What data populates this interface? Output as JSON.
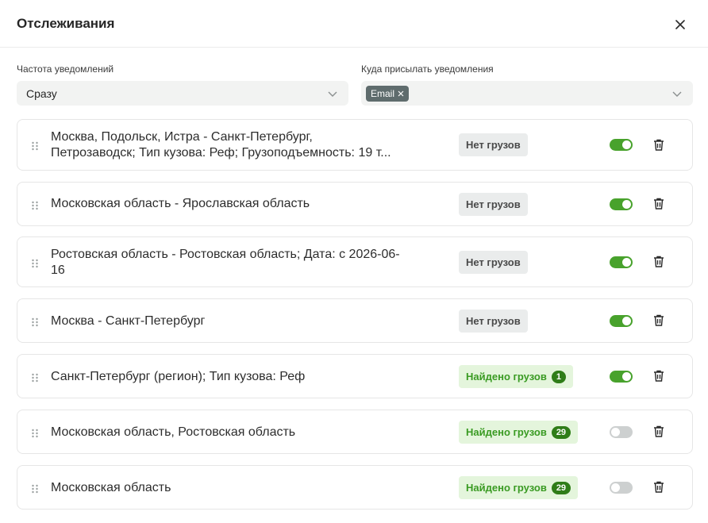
{
  "header": {
    "title": "Отслеживания"
  },
  "frequency": {
    "label": "Частота уведомлений",
    "value": "Сразу"
  },
  "destination": {
    "label": "Куда присылать уведомления",
    "chips": [
      "Email"
    ]
  },
  "colors": {
    "accent": "#48a22c",
    "badge_dark": "#2f7d18",
    "found_bg": "#e4f5dc",
    "none_bg": "#eaecec"
  },
  "subscriptions": [
    {
      "route_line1": "Москва, Подольск, Истра - Санкт-Петербург,",
      "route_line2": "Петрозаводск; Тип кузова: Реф; Грузоподъемность: 19 т...",
      "status": "Нет грузов",
      "count": "",
      "enabled": true
    },
    {
      "route_line1": "Московская область - Ярославская область",
      "route_line2": "",
      "status": "Нет грузов",
      "count": "",
      "enabled": true
    },
    {
      "route_line1": "Ростовская область - Ростовская область; Дата: с 2026-06-",
      "route_line2": "16",
      "status": "Нет грузов",
      "count": "",
      "enabled": true
    },
    {
      "route_line1": "Москва - Санкт-Петербург",
      "route_line2": "",
      "status": "Нет грузов",
      "count": "",
      "enabled": true
    },
    {
      "route_line1": "Санкт-Петербург (регион); Тип кузова: Реф",
      "route_line2": "",
      "status": "Найдено грузов",
      "count": "1",
      "enabled": true
    },
    {
      "route_line1": "Московская область, Ростовская область",
      "route_line2": "",
      "status": "Найдено грузов",
      "count": "29",
      "enabled": false
    },
    {
      "route_line1": "Московская область",
      "route_line2": "",
      "status": "Найдено грузов",
      "count": "29",
      "enabled": false
    }
  ]
}
